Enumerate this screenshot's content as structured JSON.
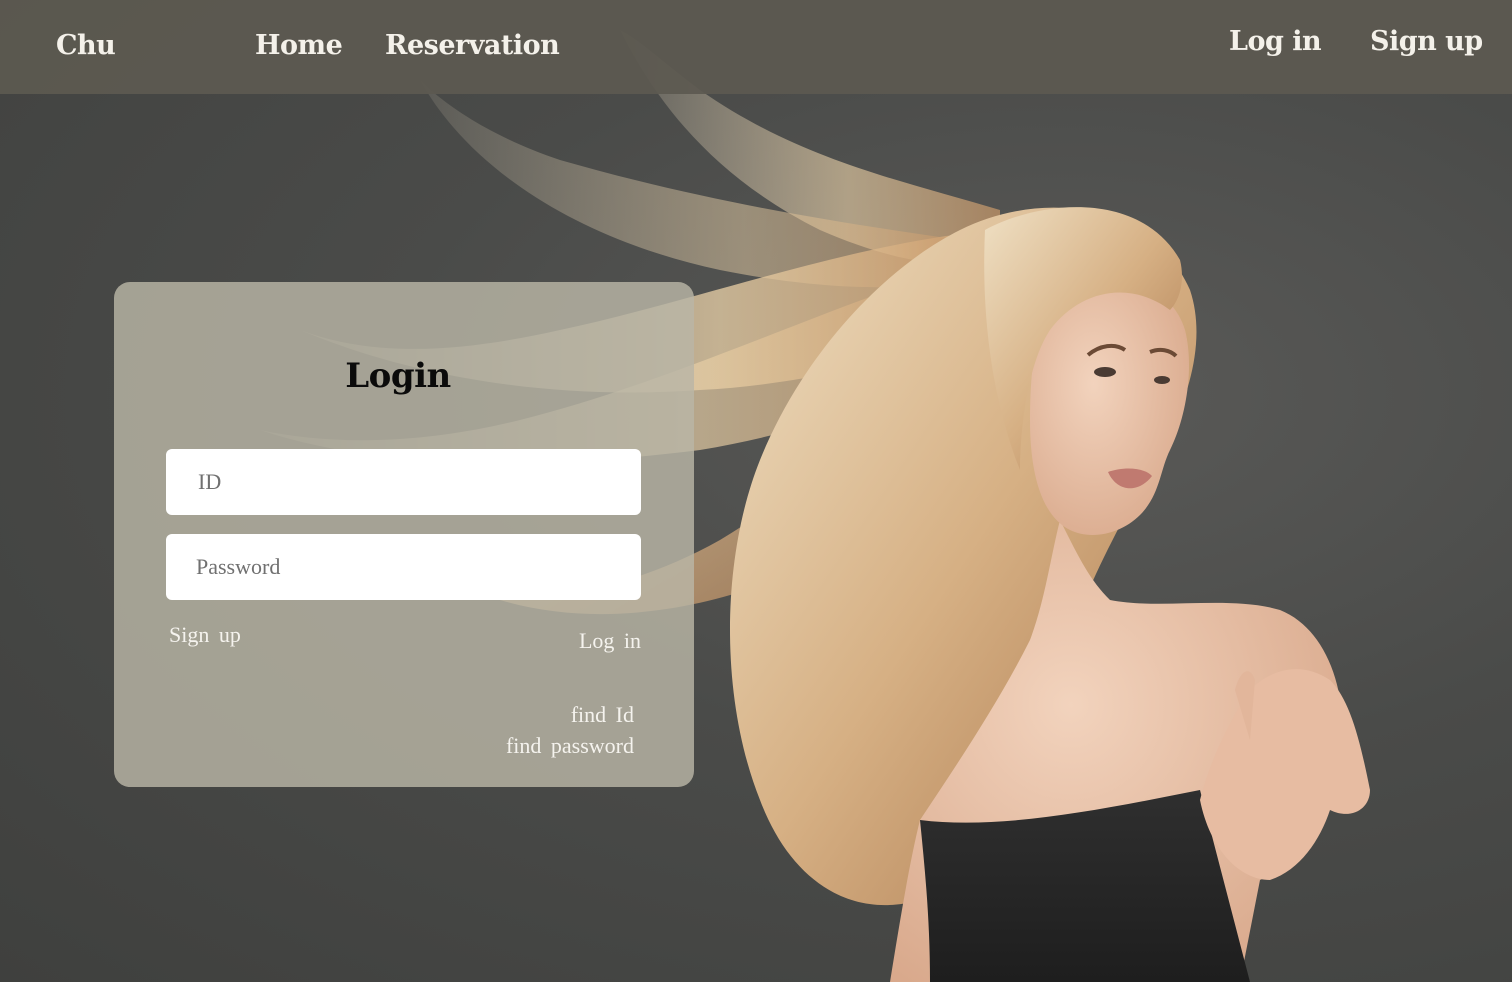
{
  "nav": {
    "brand": "Chu",
    "home": "Home",
    "reservation": "Reservation",
    "login": "Log in",
    "signup": "Sign up"
  },
  "login_card": {
    "title": "Login",
    "id_placeholder": "ID",
    "password_placeholder": "Password",
    "signup_link": "Sign up",
    "login_link": "Log in",
    "find_id_link": "find Id",
    "find_password_link": "find password"
  },
  "colors": {
    "navbar_bg": "#5c5951",
    "card_bg": "#bab6a6",
    "background": "#4a4b49",
    "nav_text": "#f4f1ea"
  }
}
